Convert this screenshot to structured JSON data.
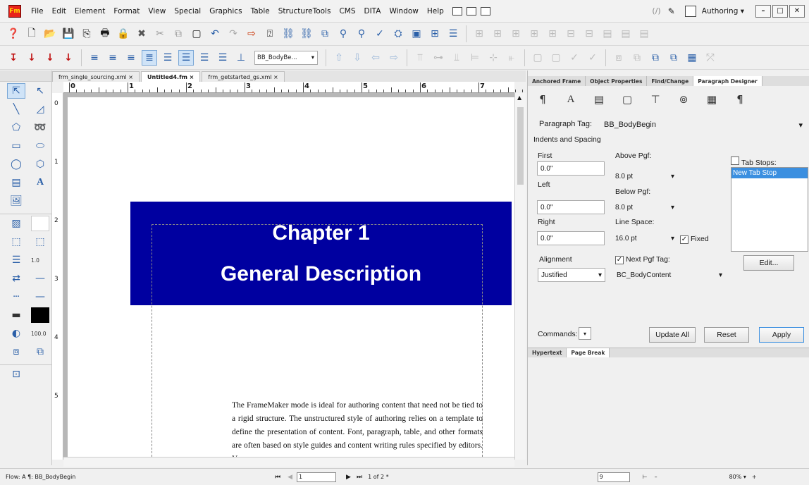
{
  "app": {
    "logo": "Fm"
  },
  "menubar": {
    "items": [
      "File",
      "Edit",
      "Element",
      "Format",
      "View",
      "Special",
      "Graphics",
      "Table",
      "StructureTools",
      "CMS",
      "DITA",
      "Window",
      "Help"
    ],
    "mode": "Authoring",
    "mode_caret": "▾",
    "window_controls": [
      "–",
      "□",
      "✕"
    ]
  },
  "toolbar2": {
    "paragraph_combo": "BB_BodyBe...",
    "combo_caret": "▾"
  },
  "doc_tabs": [
    "frm_single_sourcing.xml ×",
    "Untitled4.fm ×",
    "frm_getstarted_gs.xml ×"
  ],
  "ruler": {
    "marks": [
      "0",
      "1",
      "2",
      "3",
      "4",
      "5",
      "6",
      "7"
    ]
  },
  "vruler": {
    "marks": [
      "0",
      "1",
      "2",
      "3",
      "4",
      "5"
    ]
  },
  "page": {
    "chapter_title": "Chapter 1",
    "chapter_subtitle": "General Description",
    "body_text": "The FrameMaker mode is ideal for authoring content that need not be tied to a rigid structure. The unstructured style of authoring relies on a template to define the presentation of content. Font, paragraph, table, and other formats are often based on style guides and content writing rules specified by editors. You"
  },
  "tools": {
    "line_width": "1.0",
    "zoom_tool": "100.0"
  },
  "rpanel": {
    "tabs": [
      "Anchored Frame",
      "Object Properties",
      "Find/Change",
      "Paragraph Designer"
    ],
    "paragraph_tag_label": "Paragraph Tag:",
    "paragraph_tag": "BB_BodyBegin",
    "section": "Indents and Spacing",
    "first_label": "First",
    "first": "0.0\"",
    "left_label": "Left",
    "left": "0.0\"",
    "right_label": "Right",
    "right": "0.0\"",
    "above_label": "Above Pgf:",
    "above": "8.0 pt",
    "below_label": "Below Pgf:",
    "below": "8.0 pt",
    "linespace_label": "Line Space:",
    "linespace": "16.0 pt",
    "fixed_label": "Fixed",
    "tabstops_label": "Tab Stops:",
    "new_tab_stop": "New Tab Stop",
    "alignment_label": "Alignment",
    "alignment": "Justified",
    "next_pgf_label": "Next Pgf Tag:",
    "next_pgf": "BC_BodyContent",
    "edit_button": "Edit...",
    "commands_label": "Commands:",
    "update_all": "Update All",
    "reset": "Reset",
    "apply": "Apply",
    "bottom_tabs": [
      "Hypertext",
      "Page Break"
    ]
  },
  "statusbar": {
    "flow": "Flow: A  ¶: BB_BodyBegin",
    "page_input": "1",
    "page_count": "1 of 2 *",
    "field": "9",
    "zoom": "80%"
  }
}
